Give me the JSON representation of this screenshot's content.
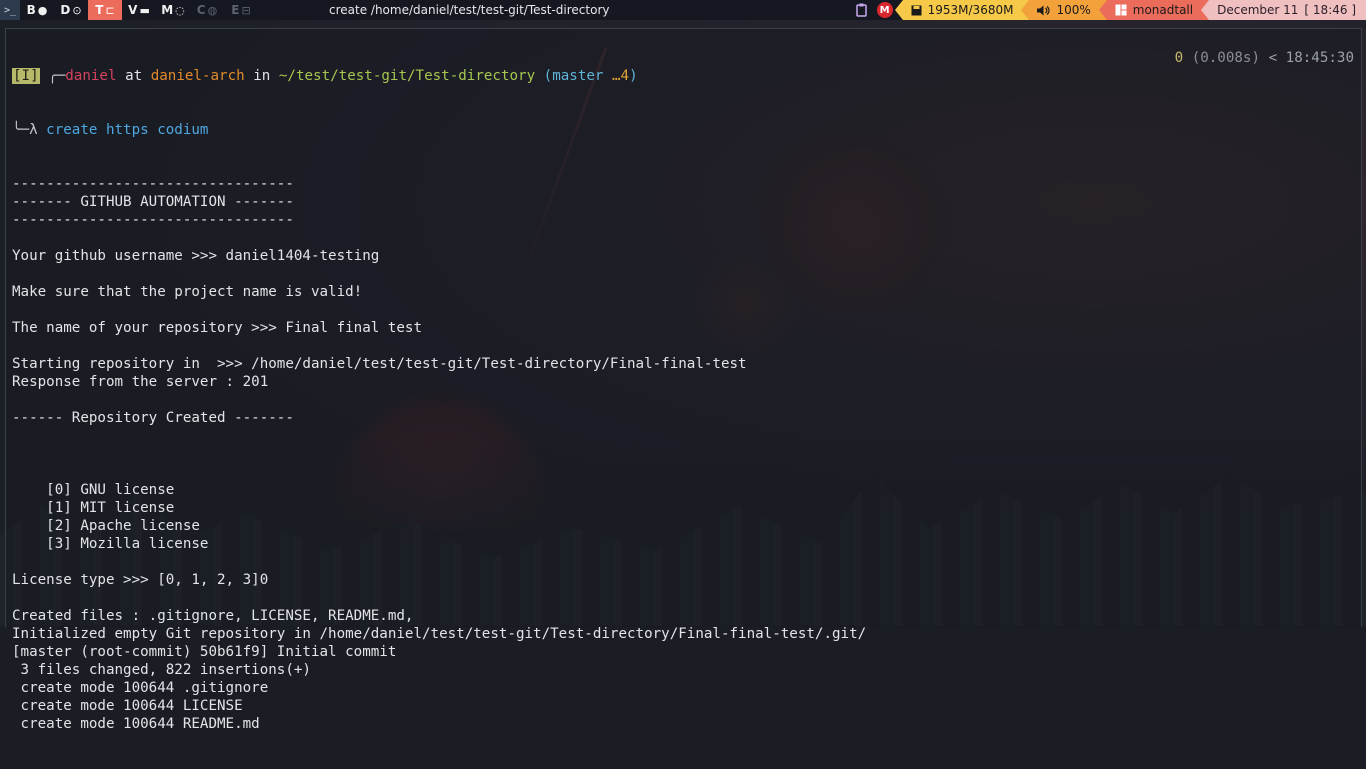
{
  "topbar": {
    "launcher_icon": "terminal-icon",
    "workspaces": [
      {
        "letter": "B",
        "symbol": "●",
        "state": "normal"
      },
      {
        "letter": "D",
        "symbol": "⊙",
        "state": "normal"
      },
      {
        "letter": "T",
        "symbol": "⊏",
        "state": "active"
      },
      {
        "letter": "V",
        "symbol": "▬",
        "state": "normal"
      },
      {
        "letter": "M",
        "symbol": "◌",
        "state": "normal"
      },
      {
        "letter": "C",
        "symbol": "◍",
        "state": "dim"
      },
      {
        "letter": "E",
        "symbol": "⊟",
        "state": "dim"
      }
    ],
    "window_title": "create /home/daniel/test/test-git/Test-directory",
    "clipboard_icon": "clipboard-icon",
    "mega_badge": "M",
    "memory": "1953M/3680M",
    "volume": "100%",
    "username": "monadtall",
    "date": "December 11",
    "time": "[ 18:46 ]",
    "colors": {
      "active_ws": "#ec6c5c",
      "memory": "#f7c948",
      "volume": "#f2a13b",
      "user": "#ec6c5c",
      "date": "#f0bfc0"
    }
  },
  "prompt": {
    "vi_mode": "[I]",
    "corner": "╭─",
    "user": "daniel",
    "at": "at",
    "host": "daniel-arch",
    "in": "in",
    "path": "~/test/test-git/Test-directory",
    "branch": "master",
    "dirty": "…4",
    "arrow": "╰─λ",
    "command": "create https codium",
    "right_status": "0",
    "right_duration": "(0.008s)",
    "right_time": "< 18:45:30"
  },
  "output": [
    "---------------------------------",
    "------- GITHUB AUTOMATION -------",
    "---------------------------------",
    "",
    "Your github username >>> daniel1404-testing",
    "",
    "Make sure that the project name is valid!",
    "",
    "The name of your repository >>> Final final test",
    "",
    "Starting repository in  >>> /home/daniel/test/test-git/Test-directory/Final-final-test",
    "Response from the server : 201",
    "",
    "------ Repository Created -------",
    "",
    "",
    "",
    "    [0] GNU license",
    "    [1] MIT license",
    "    [2] Apache license",
    "    [3] Mozilla license",
    "",
    "License type >>> [0, 1, 2, 3]0",
    "",
    "Created files : .gitignore, LICENSE, README.md,",
    "Initialized empty Git repository in /home/daniel/test/test-git/Test-directory/Final-final-test/.git/",
    "[master (root-commit) 50b61f9] Initial commit",
    " 3 files changed, 822 insertions(+)",
    " create mode 100644 .gitignore",
    " create mode 100644 LICENSE",
    " create mode 100644 README.md"
  ]
}
